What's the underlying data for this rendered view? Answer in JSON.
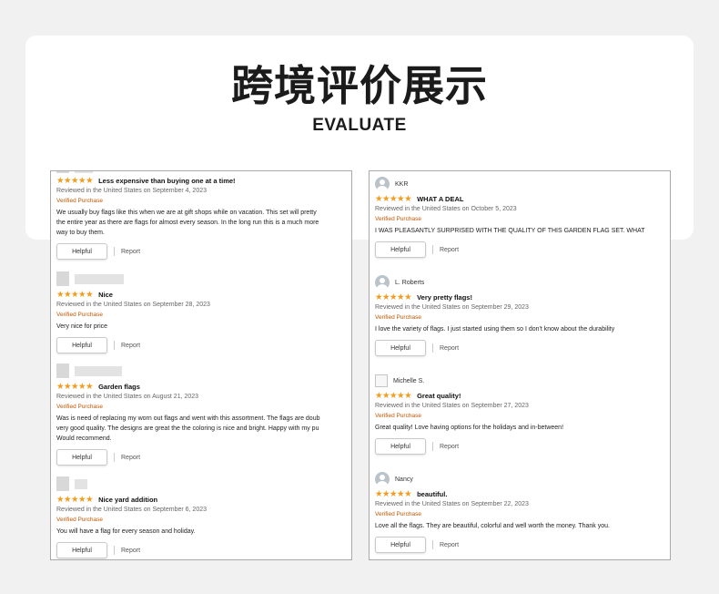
{
  "header": {
    "title": "跨境评价展示",
    "subtitle": "EVALUATE"
  },
  "colors": {
    "star": "#f29b1d",
    "verified": "#c45500",
    "background": "#f1f1f1"
  },
  "left_reviews": [
    {
      "stars": "★★★★★",
      "title": "Less expensive than buying one at a time!",
      "meta": "Reviewed in the United States on September 4, 2023",
      "verified": "Verified Purchase",
      "body": [
        "We usually buy flags like this when we are at gift shops while on vacation. This set will pretty",
        "the entire year as there are flags for almost every season. In the long run this is a much more",
        "way to buy them."
      ],
      "helpful": "Helpful",
      "report": "Report"
    },
    {
      "stars": "★★★★★",
      "title": "Nice",
      "meta": "Reviewed in the United States on September 28, 2023",
      "verified": "Verified Purchase",
      "body": [
        "Very nice for price"
      ],
      "helpful": "Helpful",
      "report": "Report"
    },
    {
      "stars": "★★★★★",
      "title": "Garden flags",
      "meta": "Reviewed in the United States on August 21, 2023",
      "verified": "Verified Purchase",
      "body": [
        "Was is need of replacing my worn out flags and went with this assortment. The flags are doub",
        "very good quality. The designs are great the the coloring is nice and bright. Happy with my pu",
        "Would recommend."
      ],
      "helpful": "Helpful",
      "report": "Report"
    },
    {
      "stars": "★★★★★",
      "title": "Nice yard addition",
      "meta": "Reviewed in the United States on September 6, 2023",
      "verified": "Verified Purchase",
      "body": [
        "You will have a flag for every season and holiday."
      ],
      "helpful": "Helpful",
      "report": "Report"
    }
  ],
  "right_reviews": [
    {
      "name": "KKR",
      "stars": "★★★★★",
      "title": "WHAT A DEAL",
      "meta": "Reviewed in the United States on October 5, 2023",
      "verified": "Verified Purchase",
      "body": [
        "I WAS PLEASANTLY SURPRISED WITH THE QUALITY OF THIS GARDEN FLAG SET. WHAT"
      ],
      "helpful": "Helpful",
      "report": "Report"
    },
    {
      "name": "L. Roberts",
      "stars": "★★★★★",
      "title": "Very pretty flags!",
      "meta": "Reviewed in the United States on September 29, 2023",
      "verified": "Verified Purchase",
      "body": [
        "I love the variety of flags. I just started using them so I don't know about the durability"
      ],
      "helpful": "Helpful",
      "report": "Report"
    },
    {
      "name": "Michelle S.",
      "stars": "★★★★★",
      "title": "Great quality!",
      "meta": "Reviewed in the United States on September 27, 2023",
      "verified": "Verified Purchase",
      "body": [
        "Great quality! Love having options for the holidays and in-between!"
      ],
      "helpful": "Helpful",
      "report": "Report"
    },
    {
      "name": "Nancy",
      "stars": "★★★★★",
      "title": "beautiful.",
      "meta": "Reviewed in the United States on September 22, 2023",
      "verified": "Verified Purchase",
      "body": [
        "Love all the flags. They are beautiful, colorful and well worth the money. Thank you."
      ],
      "helpful": "Helpful",
      "report": "Report"
    }
  ]
}
